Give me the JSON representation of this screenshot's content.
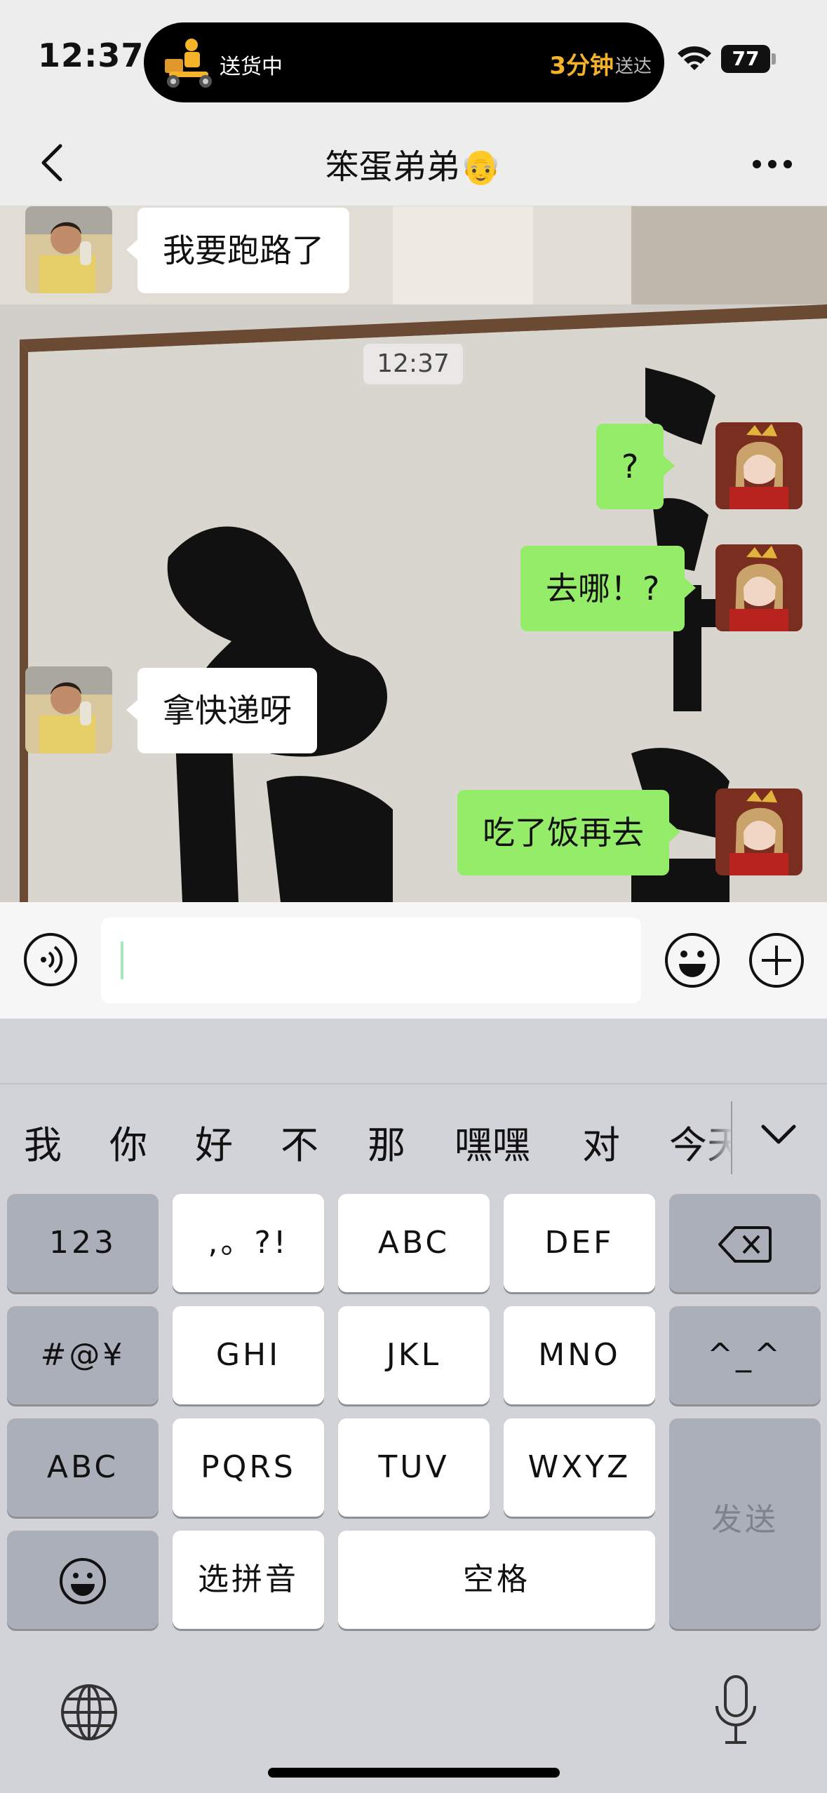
{
  "status_bar": {
    "time": "12:37",
    "live_activity": {
      "status": "送货中",
      "eta": "3分钟",
      "eta_suffix": "送达"
    },
    "battery": "77"
  },
  "nav": {
    "title": "笨蛋弟弟👴"
  },
  "messages": [
    {
      "side": "in",
      "text": "我要跑路了"
    },
    {
      "side": "out",
      "text": "?"
    },
    {
      "side": "out",
      "text": "去哪！?"
    },
    {
      "side": "in",
      "text": "拿快递呀"
    },
    {
      "side": "out",
      "text": "吃了饭再去"
    }
  ],
  "timestamp": "12:37",
  "input": {
    "value": ""
  },
  "keyboard": {
    "candidates": [
      "我",
      "你",
      "好",
      "不",
      "那",
      "嘿嘿",
      "对",
      "今天"
    ],
    "keys": {
      "num": "123",
      "punct": ",。?!",
      "abc": "ABC",
      "def": "DEF",
      "symbols": "#@¥",
      "ghi": "GHI",
      "jkl": "JKL",
      "mno": "MNO",
      "emoticon": "^_^",
      "abc_mode": "ABC",
      "pqrs": "PQRS",
      "tuv": "TUV",
      "wxyz": "WXYZ",
      "send": "发送",
      "pinyin": "选拼音",
      "space": "空格"
    }
  },
  "colors": {
    "outgoing_bubble": "#95ec69",
    "incoming_bubble": "#ffffff",
    "eta_accent": "#f5b32a",
    "keyboard_bg": "#d1d3d9"
  },
  "icons": [
    "scooter-icon",
    "wifi-icon",
    "back-arrow-icon",
    "more-icon",
    "voice-icon",
    "emoji-icon",
    "plus-icon",
    "chevron-down-icon",
    "backspace-icon",
    "smiley-icon",
    "globe-icon",
    "microphone-icon"
  ]
}
